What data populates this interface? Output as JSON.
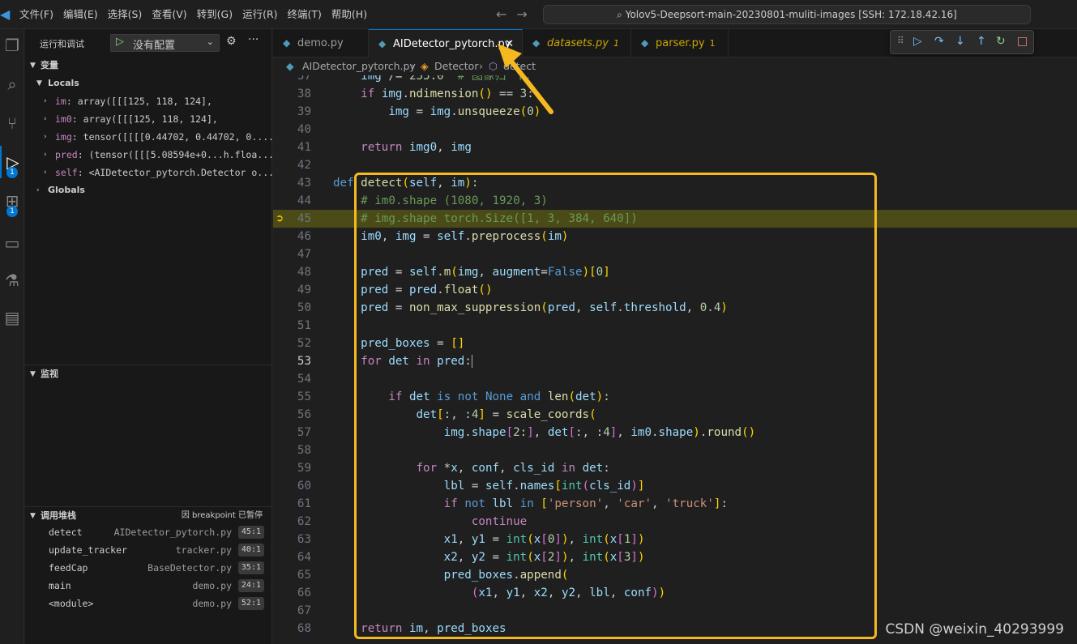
{
  "menu": [
    "文件(F)",
    "编辑(E)",
    "选择(S)",
    "查看(V)",
    "转到(G)",
    "运行(R)",
    "终端(T)",
    "帮助(H)"
  ],
  "command_center": "Yolov5-Deepsort-main-20230801-muliti-images [SSH: 172.18.42.16]",
  "activity_badges": {
    "run": "1",
    "extensions": "1"
  },
  "sidebar": {
    "title": "运行和调试",
    "config": "没有配置",
    "variables_title": "变量",
    "locals_title": "Locals",
    "locals": [
      {
        "name": "im",
        "value": "array([[[125, 118, 124],"
      },
      {
        "name": "im0",
        "value": "array([[[125, 118, 124],"
      },
      {
        "name": "img",
        "value": "tensor([[[[0.44702, 0.44702, 0...."
      },
      {
        "name": "pred",
        "value": "(tensor([[[5.08594e+0...h.floa..."
      },
      {
        "name": "self",
        "value": "<AIDetector_pytorch.Detector o..."
      }
    ],
    "globals_title": "Globals",
    "watch_title": "监视",
    "callstack_title": "调用堆栈",
    "callstack_status": "因 breakpoint 已暂停",
    "callstack": [
      {
        "fn": "detect",
        "file": "AIDetector_pytorch.py",
        "pos": "45:1"
      },
      {
        "fn": "update_tracker",
        "file": "tracker.py",
        "pos": "40:1"
      },
      {
        "fn": "feedCap",
        "file": "BaseDetector.py",
        "pos": "35:1"
      },
      {
        "fn": "main",
        "file": "demo.py",
        "pos": "24:1"
      },
      {
        "fn": "<module>",
        "file": "demo.py",
        "pos": "52:1"
      }
    ]
  },
  "tabs": [
    {
      "label": "demo.py",
      "count": ""
    },
    {
      "label": "AIDetector_pytorch.py",
      "count": ""
    },
    {
      "label": "datasets.py",
      "count": "1"
    },
    {
      "label": "parser.py",
      "count": "1"
    }
  ],
  "breadcrumbs": [
    "AIDetector_pytorch.py",
    "Detector",
    "detect"
  ],
  "line_numbers": [
    "37",
    "38",
    "39",
    "40",
    "41",
    "42",
    "43",
    "44",
    "45",
    "46",
    "47",
    "48",
    "49",
    "50",
    "51",
    "52",
    "53",
    "54",
    "55",
    "56",
    "57",
    "58",
    "59",
    "60",
    "61",
    "62",
    "63",
    "64",
    "65",
    "66",
    "67",
    "68"
  ],
  "watermark": "CSDN @weixin_40293999",
  "colors": {
    "accent": "#0078d4",
    "highlight_box": "#f5b820",
    "current_line": "#4b4b18"
  }
}
